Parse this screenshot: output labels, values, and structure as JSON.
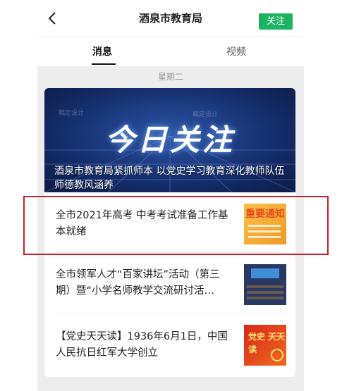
{
  "header": {
    "back_icon": "chevron-left-icon",
    "title": "酒泉市教育局",
    "follow_label": "关注",
    "follow_color": "#1bb463"
  },
  "tabs": [
    {
      "label": "消息",
      "active": true
    },
    {
      "label": "视频",
      "active": false
    }
  ],
  "feed": {
    "date_label": "星期二",
    "cover": {
      "headline": "今日关注",
      "watermark": "稿定设计",
      "caption": "酒泉市教育局紧抓师本 以党史学习教育深化教师队伍师德教风涵养"
    },
    "items": [
      {
        "title": "全市2021年高考 中考考试准备工作基本就绪",
        "thumb_text": "重要通知"
      },
      {
        "title": "全市领军人才“百家讲坛”活动（第三期）暨“小学名师教学交流研讨活…"
      },
      {
        "title": "【党史天天读】1936年6月1日，中国人民抗日红军大学创立",
        "thumb_text": "党史 天天读"
      }
    ]
  },
  "highlight_color": "#cc1f2a"
}
